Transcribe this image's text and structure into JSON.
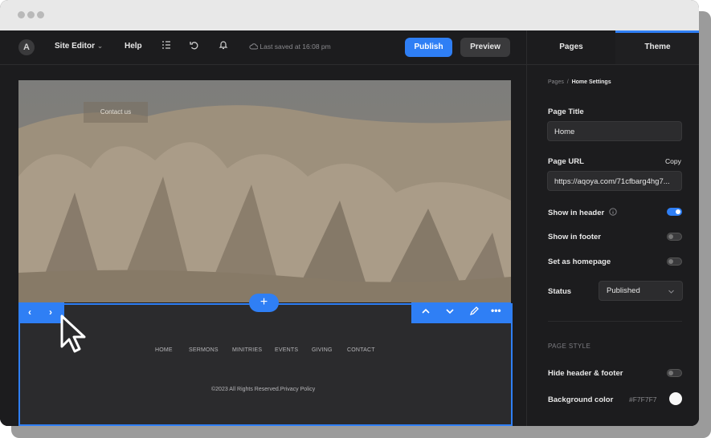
{
  "toolbar": {
    "logo": "A",
    "site_editor": "Site Editor",
    "help": "Help",
    "saved_status": "Last saved at 16:08 pm",
    "publish": "Publish",
    "preview": "Preview",
    "icons": [
      "checklist-icon",
      "undo-icon",
      "bell-icon",
      "cloud-icon"
    ]
  },
  "canvas": {
    "hero": {
      "contact_button": "Contact us"
    },
    "footer": {
      "nav": [
        "HOME",
        "SERMONS",
        "MINITRIES",
        "EVENTS",
        "GIVING",
        "CONTACT"
      ],
      "copyright": "©2023 All Rights Reserved.Privacy Policy"
    }
  },
  "panel": {
    "tabs": [
      "Pages",
      "Theme"
    ],
    "active_tab": "Theme",
    "breadcrumb": {
      "root": "Pages",
      "separator": "/",
      "current": "Home Settings"
    },
    "page_title_label": "Page Title",
    "page_title_value": "Home",
    "page_url_label": "Page URL",
    "copy": "Copy",
    "page_url_value": "https://aqoya.com/71cfbarg4hg7...",
    "show_in_header": "Show in header",
    "show_in_header_on": true,
    "show_in_footer": "Show in footer",
    "show_in_footer_on": false,
    "set_homepage": "Set as homepage",
    "set_homepage_on": false,
    "status_label": "Status",
    "status_value": "Published",
    "page_style_heading": "PAGE STYLE",
    "hide_header_footer": "Hide header & footer",
    "hide_header_footer_on": false,
    "background_color_label": "Background color",
    "background_color_value": "#F7F7F7"
  },
  "colors": {
    "accent": "#2f7ff5",
    "panel_bg": "#1c1c1e",
    "footer_bg": "#2b2b2d"
  }
}
